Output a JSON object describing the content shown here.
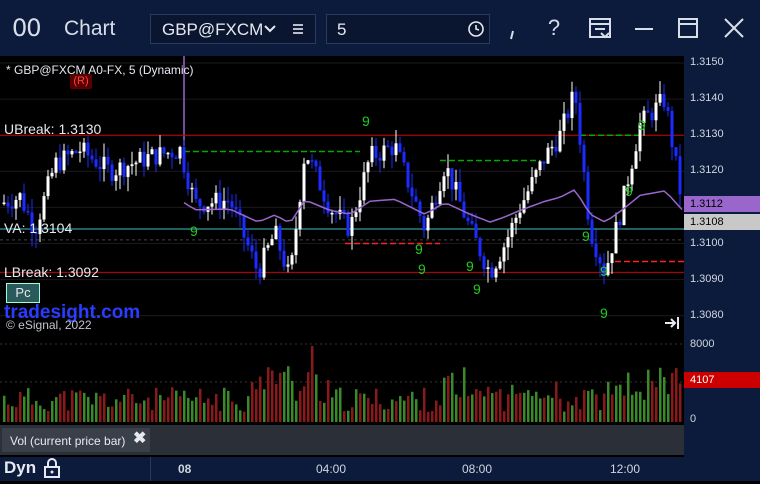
{
  "window": {
    "icon_text": "00",
    "title": "Chart",
    "symbol": "GBP@FXCM",
    "interval": "5"
  },
  "toolbar": {
    "buttons": [
      "link-icon",
      "help-icon",
      "layout-icon",
      "minimize-icon",
      "maximize-icon",
      "close-icon"
    ],
    "help_glyph": "?",
    "link_glyph": "ı"
  },
  "chart": {
    "header": "* GBP@FXCM A0-FX, 5 (Dynamic)",
    "r_badge": "(R)",
    "ubreak": "UBreak: 1.3130",
    "va": "VA: 1.3104",
    "lbreak": "LBreak: 1.3092",
    "pc": "Pc",
    "watermark": "tradesight.com",
    "copyright": "© eSignal, 2022",
    "price_axis": [
      "1.3150",
      "1.3140",
      "1.3130",
      "1.3120",
      "1.3110",
      "1.3100",
      "1.3090",
      "1.3080"
    ],
    "price_tag_purple": "1.3112",
    "price_tag_gray": "1.3108",
    "ubreak_value": 1.313,
    "va_value": 1.3104,
    "lbreak_value": 1.3092,
    "colors": {
      "up": "#ffffff",
      "down": "#1a2cff",
      "ubreak": "#cc0000",
      "va": "#40c0c0",
      "vwap": "#9966cc",
      "green_dash": "#00aa00",
      "red_dash": "#ff2020",
      "seq": "#22cc22"
    }
  },
  "volume": {
    "label": "Vol (current price bar)",
    "close_glyph": "✖",
    "axis": [
      "8000",
      "0"
    ],
    "tag": "4107",
    "tag_color": "#cc0000"
  },
  "timeaxis": {
    "dyn": "Dyn",
    "labels": [
      "08",
      "04:00",
      "08:00",
      "12:00"
    ]
  }
}
